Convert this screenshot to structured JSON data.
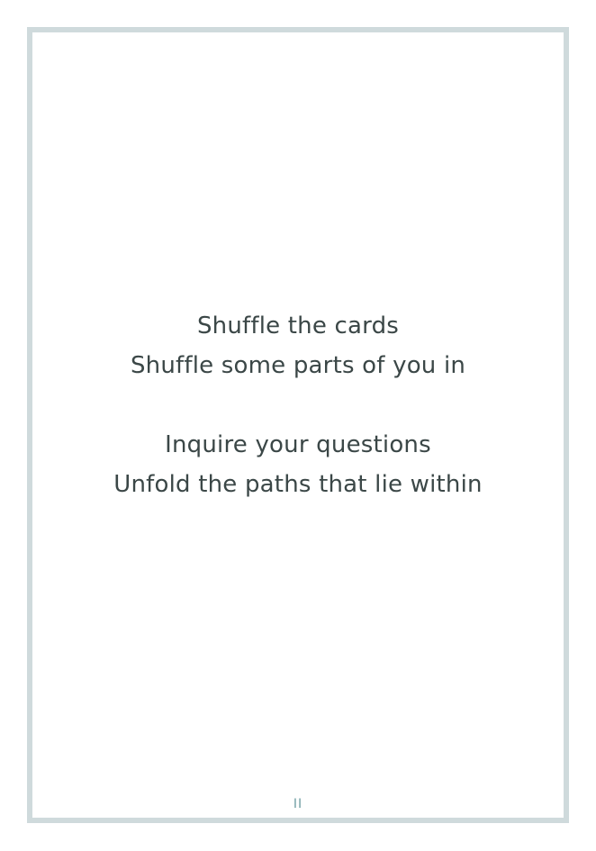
{
  "poem": {
    "stanza1": [
      "Shuffle the cards",
      "Shuffle some parts of you in"
    ],
    "stanza2": [
      "Inquire your questions",
      "Unfold the paths that lie within"
    ]
  },
  "page_number": "II",
  "colors": {
    "border": "#cfdadc",
    "text": "#3b4747",
    "page_number": "#6f9ea3"
  }
}
